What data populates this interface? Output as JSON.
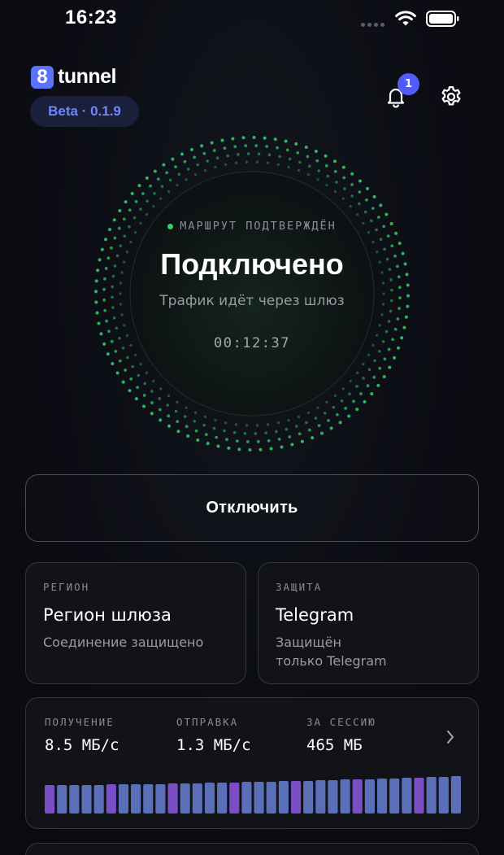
{
  "status_bar": {
    "time": "16:23"
  },
  "header": {
    "logo_mark": "8",
    "logo_text": "tunnel",
    "version_badge": "Beta · 0.1.9",
    "notification_count": "1"
  },
  "connection": {
    "route_status": "МАРШРУТ ПОДТВЕРЖДЁН",
    "title": "Подключено",
    "subtitle": "Трафик идёт через шлюз",
    "timer": "00:12:37"
  },
  "actions": {
    "disconnect_label": "Отключить"
  },
  "region_card": {
    "label": "РЕГИОН",
    "value": "Регион шлюза",
    "sub": "Соединение защищено"
  },
  "protection_card": {
    "label": "ЗАЩИТА",
    "value": "Telegram",
    "sub_line1": "Защищён",
    "sub_line2": "только Telegram"
  },
  "traffic": {
    "receive_label": "ПОЛУЧЕНИЕ",
    "receive_value": "8.5 МБ/с",
    "send_label": "ОТПРАВКА",
    "send_value": "1.3 МБ/с",
    "session_label": "ЗА СЕССИЮ",
    "session_value": "465 МБ",
    "bar_heights": [
      0.7,
      0.7,
      0.7,
      0.7,
      0.7,
      0.72,
      0.72,
      0.72,
      0.72,
      0.72,
      0.74,
      0.74,
      0.74,
      0.76,
      0.76,
      0.76,
      0.78,
      0.78,
      0.78,
      0.8,
      0.8,
      0.8,
      0.82,
      0.82,
      0.84,
      0.84,
      0.84,
      0.86,
      0.86,
      0.88,
      0.88,
      0.9,
      0.9,
      0.92
    ],
    "bar_accent_every": 5
  },
  "colors": {
    "accent": "#5b72ff",
    "connected": "#36d168",
    "bar_blue": "#5b6fb8",
    "bar_purple": "#7a4fc6"
  },
  "icons": {
    "bell": "bell-icon",
    "gear": "gear-icon",
    "chevron": "chevron-right-icon",
    "wifi": "wifi-icon",
    "battery": "battery-icon"
  }
}
